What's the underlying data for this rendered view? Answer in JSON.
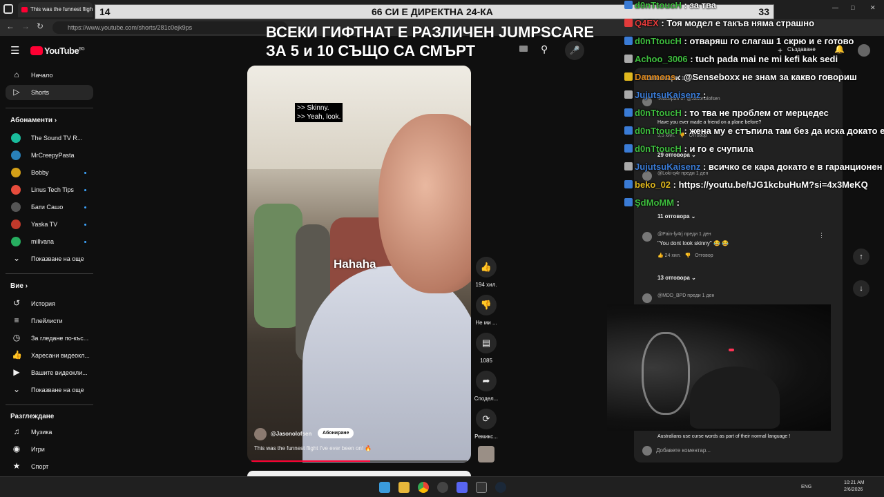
{
  "browser": {
    "tab_title": "This was the funnest flight",
    "url": "https://www.youtube.com/shorts/281c0ejk9ps"
  },
  "youtube": {
    "logo": "YouTube",
    "country": "BG",
    "nav_home": "Начало",
    "nav_shorts": "Shorts",
    "subs_header": "Абонаменти",
    "subscriptions": [
      {
        "name": "The Sound TV R...",
        "color": "#1abc9c"
      },
      {
        "name": "MrCreepyPasta",
        "color": "#2980b9"
      },
      {
        "name": "Bobby",
        "color": "#d4a017"
      },
      {
        "name": "Linus Tech Tips",
        "color": "#e74c3c"
      },
      {
        "name": "Бати Сашо",
        "color": "#555555"
      },
      {
        "name": "Yaska TV",
        "color": "#c0392b"
      },
      {
        "name": "millvana",
        "color": "#27ae60"
      }
    ],
    "show_more": "Показване на още",
    "you_header": "Вие",
    "you_items": [
      "История",
      "Плейлисти",
      "За гледане по-къс...",
      "Харесани видеокл...",
      "Вашите видеокли...",
      "Показване на още"
    ],
    "explore_header": "Разглеждане",
    "explore_items": [
      "Музика",
      "Игри",
      "Спорт"
    ],
    "create": "Създаване"
  },
  "video": {
    "caption": ">> Skinny.\n>> Yeah, look.",
    "overlay_word": "Hahaha",
    "channel": "@Jasonolofsen",
    "subscribe": "Абониране",
    "title": "This was the funnest flight I've ever been on! 🔥",
    "progress": 0.55,
    "likes": "194 хил.",
    "dislike": "Не ми ...",
    "comments_count": "1085",
    "share": "Сподел...",
    "remix": "Ремикс..."
  },
  "stream": {
    "big_text_line1": "ВСЕКИ ГИФТНАТ Е РАЗЛИЧЕН JUMPSCARE",
    "big_text_line2": "ЗА 5 и 10 СЪЩО СА СМЪРТ",
    "goal_left": "14",
    "goal_center": "66 СИ Е ДИРЕКТНА 24-КА",
    "goal_right": "33"
  },
  "comments_panel": {
    "header": "Коментари",
    "header_count": "1 хил.",
    "pinned_note": "Фиксиран от @Jasonolofsen",
    "c1_text": "Have you ever made a friend on a plane before?",
    "c1_likes": "3,5 хил.",
    "reply": "Отговор",
    "c1_replies": "29 отговора",
    "c2_author": "@Loki-q4r",
    "c2_time": "преди 1 ден",
    "c2_replies": "11 отговора",
    "c3_author": "@Pain-fy4rj",
    "c3_time": "преди 1 ден",
    "c3_text": "\"You dont look skinny\" 😂 😂",
    "c3_likes": "24 хил.",
    "c3_replies": "13 отговора",
    "c4_author": "@MDD_BPD",
    "c4_time": "преди 1 ден",
    "c5_text": "Australians use curse words as part of their normal language !",
    "add_comment": "Добавете коментар..."
  },
  "chat": [
    {
      "user": "d0nTtoucH",
      "msg": ": за тва",
      "color": "#3fbf3f"
    },
    {
      "user": "Q4EX",
      "msg": ": Тоя модел е такъв няма страшно",
      "color": "#e23b3b"
    },
    {
      "user": "d0nTtoucH",
      "msg": ": отваряш го слагаш 1 скрю и е готово",
      "color": "#3fbf3f"
    },
    {
      "user": "Achoo_3006",
      "msg": ": tuch pada mai ne mi kefi kak sedi",
      "color": "#3fbf3f"
    },
    {
      "user": "Danmons",
      "msg": ": @Senseboxx не знам за какво говориш",
      "color": "#e08a1e"
    },
    {
      "user": "JujutsuKaisenz",
      "msg": ":",
      "color": "#3a7bd5"
    },
    {
      "user": "d0nTtoucH",
      "msg": ": то тва не проблем от мерцедес",
      "color": "#3fbf3f"
    },
    {
      "user": "d0nTtoucH",
      "msg": ": жена му е стъпила там без да иска докато е",
      "color": "#3fbf3f"
    },
    {
      "user": "d0nTtoucH",
      "msg": ": и го е счупила",
      "color": "#3fbf3f"
    },
    {
      "user": "JujutsuKaisenz",
      "msg": ": всичко се кара докато е в гаранционен срок",
      "color": "#3a7bd5"
    },
    {
      "user": "beko_02",
      "msg": ": https://youtu.be/tJG1kcbuHuM?si=4x3MeKQ",
      "color": "#e0b81e"
    },
    {
      "user": "ŞdMoMM",
      "msg": ":",
      "color": "#3fbf3f"
    }
  ],
  "taskbar": {
    "lang": "ENG",
    "time": "10:21 AM",
    "date": "2/6/2026"
  }
}
